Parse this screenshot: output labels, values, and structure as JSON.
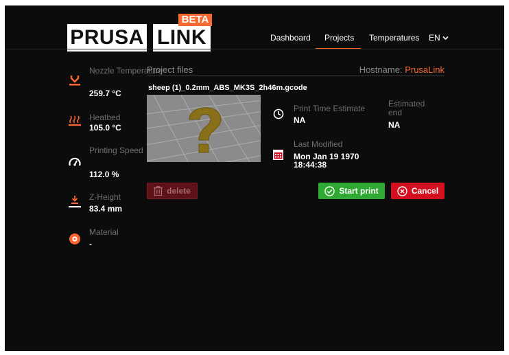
{
  "logo": {
    "part1": "PRUSA",
    "part2": "LINK",
    "badge": "BETA"
  },
  "nav": {
    "items": [
      {
        "label": "Dashboard"
      },
      {
        "label": "Projects"
      },
      {
        "label": "Temperatures"
      }
    ],
    "active": "Projects",
    "language": "EN"
  },
  "sidebar": {
    "nozzle": {
      "label": "Nozzle Temperature",
      "value": "259.7 °C",
      "icon": "nozzle-icon"
    },
    "heatbed": {
      "label": "Heatbed",
      "value": "105.0 °C",
      "icon": "heatbed-icon"
    },
    "speed": {
      "label": "Printing Speed",
      "value": "112.0 %",
      "icon": "speedometer-icon"
    },
    "zheight": {
      "label": "Z-Height",
      "value": "83.4 mm",
      "icon": "z-height-icon"
    },
    "material": {
      "label": "Material",
      "value": "-",
      "icon": "filament-spool-icon"
    }
  },
  "main": {
    "title": "Project files",
    "hostname_label": "Hostname:",
    "hostname_value": "PrusaLink",
    "filename": "sheep (1)_0.2mm_ABS_MK3S_2h46m.gcode",
    "print_time_label": "Print Time Estimate",
    "print_time_value": "NA",
    "est_end_label_1": "Estimated",
    "est_end_label_2": "end",
    "est_end_value": "NA",
    "last_modified_label": "Last Modified",
    "last_modified_value_1": "Mon Jan 19 1970",
    "last_modified_value_2": "18:44:38",
    "delete_label": "delete",
    "start_label": "Start print",
    "cancel_label": "Cancel"
  },
  "colors": {
    "accent": "#fa6831",
    "background": "#0c0c0c",
    "start": "#2fa934",
    "cancel": "#d2101f",
    "delete": "#5d1217"
  }
}
